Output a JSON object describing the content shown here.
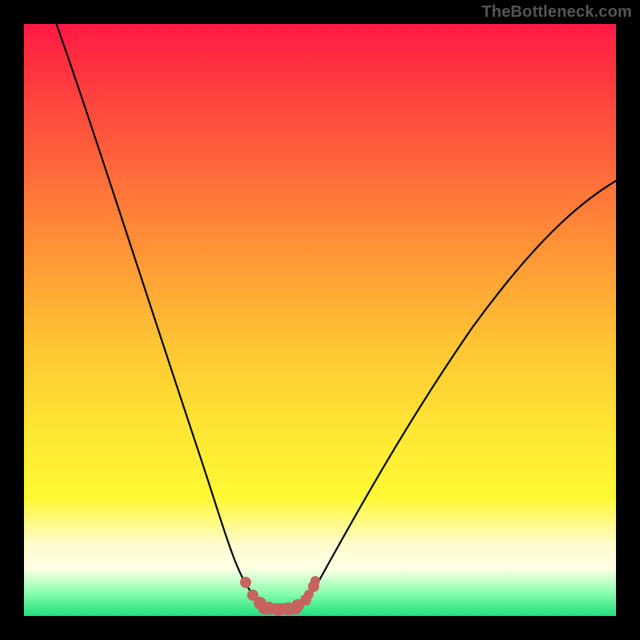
{
  "watermark": {
    "text": "TheBottleneck.com"
  },
  "colors": {
    "background": "#000000",
    "curve_main": "#000000",
    "marker": "#c7635f",
    "gradient_stops": [
      "#ff1a44",
      "#ff6a3a",
      "#ffc733",
      "#fff833",
      "#fffccf",
      "#1ee07a"
    ]
  },
  "chart_data": {
    "type": "line",
    "title": "",
    "xlabel": "",
    "ylabel": "",
    "xlim": [
      0,
      100
    ],
    "ylim": [
      0,
      100
    ],
    "grid": false,
    "legend": false,
    "series": [
      {
        "name": "bottleneck-curve",
        "x": [
          5,
          10,
          15,
          20,
          25,
          30,
          33,
          35,
          37,
          40,
          42,
          44,
          46,
          50,
          55,
          60,
          70,
          80,
          90,
          100
        ],
        "values": [
          100,
          84,
          68,
          52,
          36,
          20,
          10,
          5,
          2,
          0.5,
          0,
          0,
          0.5,
          2,
          8,
          15,
          30,
          45,
          55,
          63
        ]
      }
    ],
    "markers": {
      "name": "optimal-band",
      "x": [
        37,
        38,
        39,
        40,
        41,
        42,
        43,
        44,
        45,
        46,
        47
      ],
      "values": [
        5,
        2.5,
        1.2,
        0.6,
        0.2,
        0.1,
        0.2,
        0.5,
        1.0,
        2.0,
        3.5
      ]
    }
  }
}
